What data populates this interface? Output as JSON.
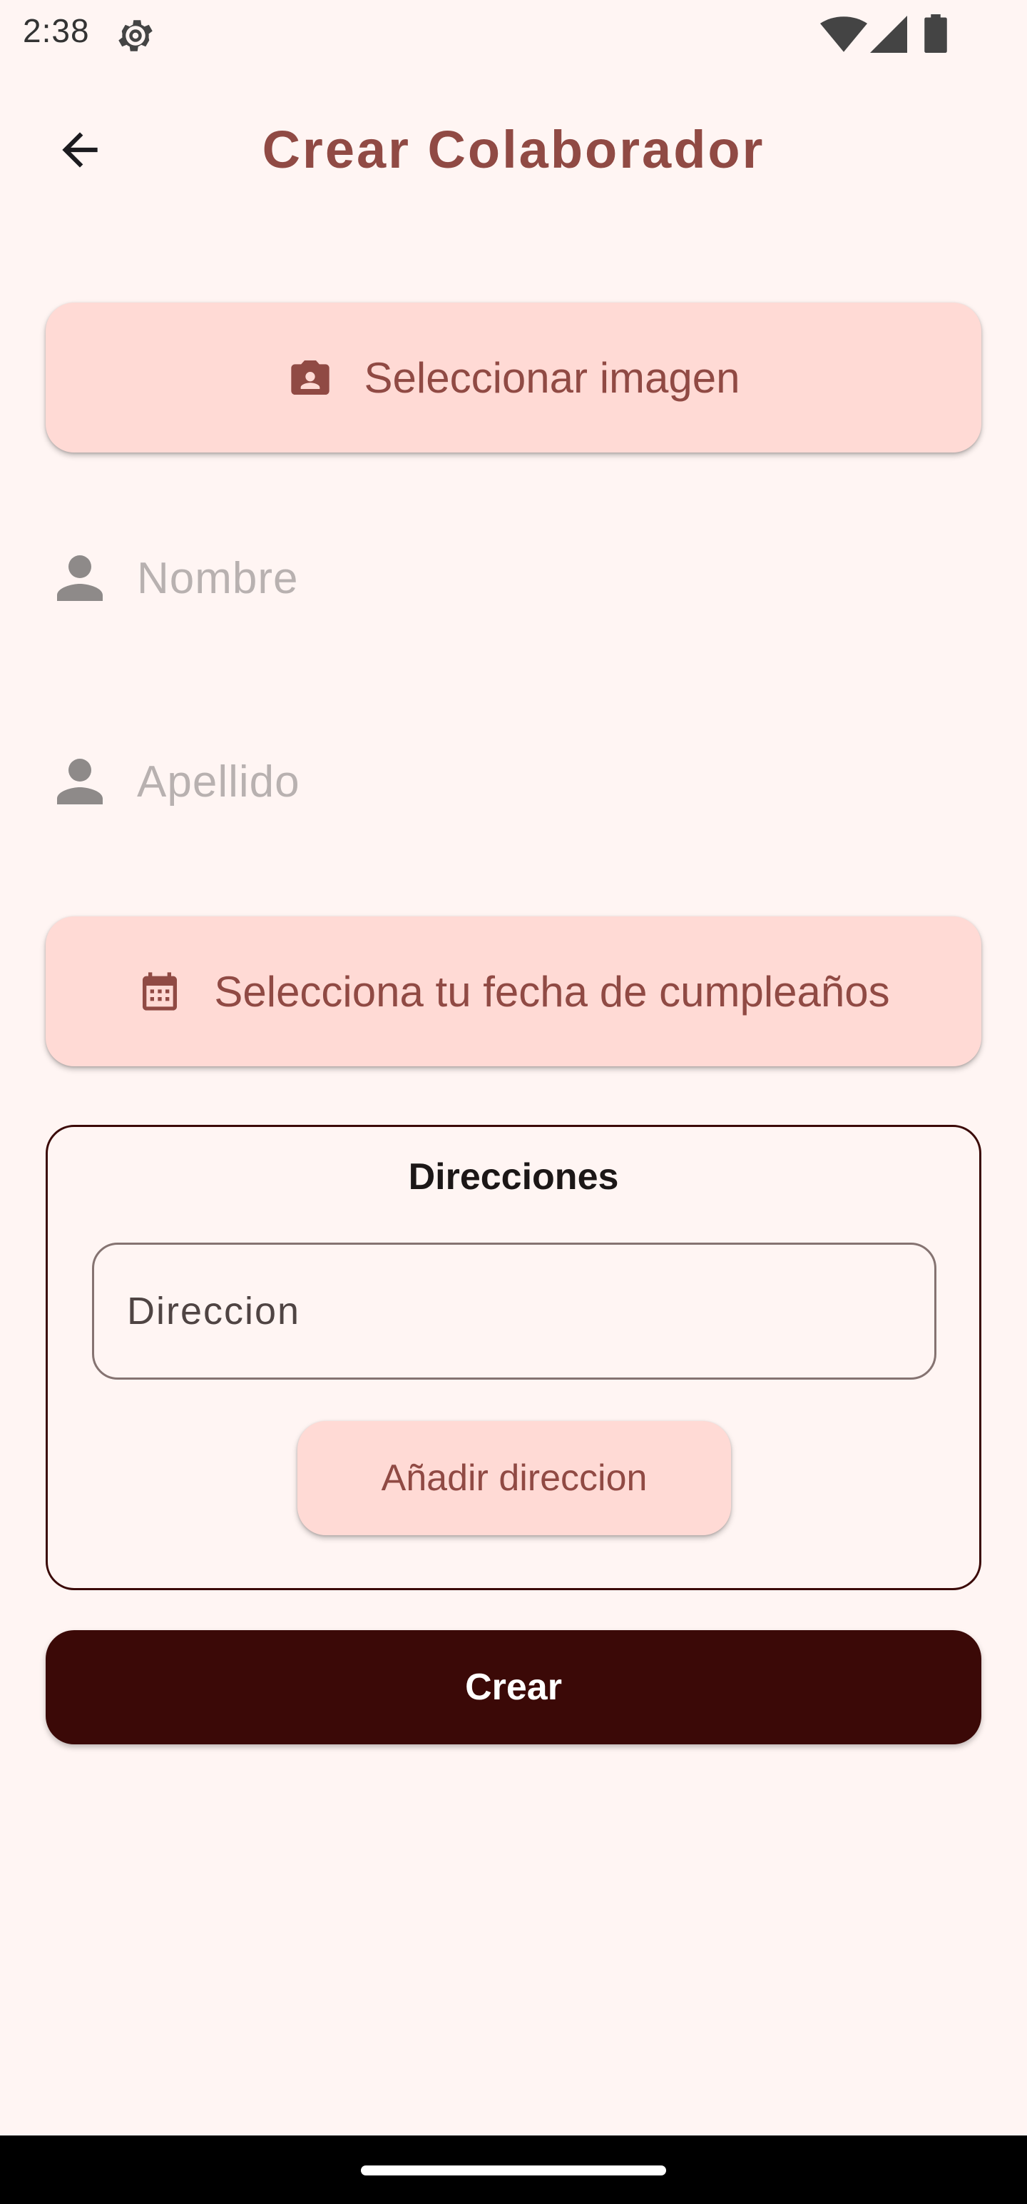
{
  "status_bar": {
    "time": "2:38",
    "icons": [
      "gear-icon",
      "wifi-icon",
      "signal-icon",
      "battery-icon"
    ]
  },
  "app_bar": {
    "title": "Crear Colaborador",
    "back_icon": "arrow-back-icon"
  },
  "form": {
    "select_image_label": "Seleccionar imagen",
    "select_image_icon": "camera-box-icon",
    "nombre_placeholder": "Nombre",
    "apellido_placeholder": "Apellido",
    "field_icon": "person-icon",
    "birthday_label": "Selecciona tu fecha de cumpleaños",
    "birthday_icon": "calendar-icon"
  },
  "addresses": {
    "title": "Direcciones",
    "input_placeholder": "Direccion",
    "add_button_label": "Añadir direccion"
  },
  "actions": {
    "create_label": "Crear"
  },
  "colors": {
    "background": "#fff5f3",
    "accent": "#904a44",
    "tonal_container": "#ffdad5",
    "primary_dark": "#3b0907"
  }
}
